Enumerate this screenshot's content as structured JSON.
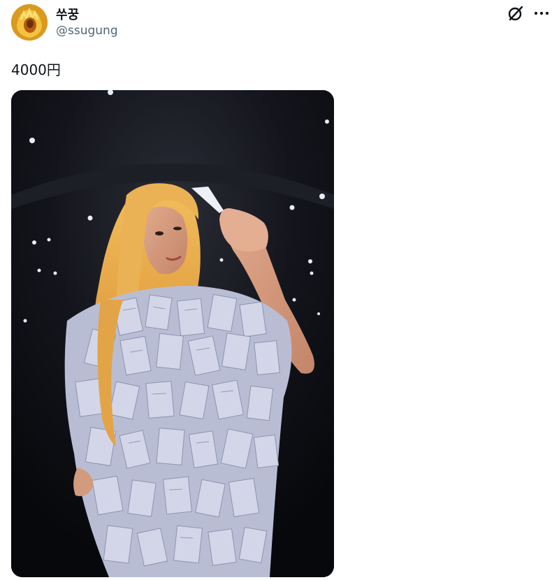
{
  "post": {
    "author": {
      "display_name": "쑤꿍",
      "handle": "@ssugung",
      "avatar_icon": "avatar-image"
    },
    "actions": {
      "grok_icon": "grok-icon",
      "more_icon": "more-options-icon"
    },
    "text": "4000円",
    "media": {
      "type": "photo",
      "background_color": "#0a0b10",
      "wig_color": "#e8a84a",
      "receipt_color": "#c7cbe0"
    }
  }
}
